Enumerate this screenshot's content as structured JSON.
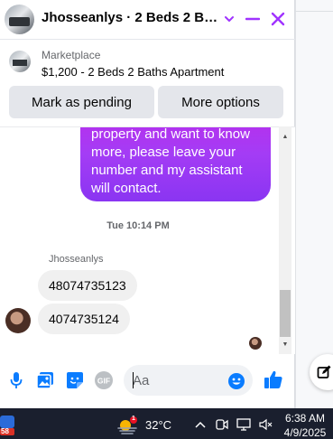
{
  "header": {
    "title": "Jhosseanlys · 2 Beds 2 Bat…",
    "icons": [
      "chevron-down-icon",
      "minimize-icon",
      "close-icon"
    ],
    "accent_color": "#a033ff"
  },
  "listing": {
    "label": "Marketplace",
    "summary": "$1,200 - 2 Beds 2 Baths Apartment"
  },
  "actions": {
    "mark_pending": "Mark as pending",
    "more_options": "More options"
  },
  "messages": {
    "outgoing_text": "property and want to know more, please leave your number and my assistant will contact.",
    "timestamp": "Tue 10:14 PM",
    "sender_name": "Jhosseanlys",
    "incoming": [
      "48074735123",
      "4074735124"
    ]
  },
  "composer": {
    "placeholder": "Aa",
    "icons": [
      "microphone-icon",
      "photo-icon",
      "sticker-icon",
      "gif-icon",
      "emoji-icon",
      "thumbs-up-icon"
    ],
    "gif_label": "GIF"
  },
  "taskbar": {
    "badge_left": "58",
    "weather_badge": "1",
    "temperature": "32°C",
    "time": "6:38 AM",
    "date": "4/9/2025"
  }
}
